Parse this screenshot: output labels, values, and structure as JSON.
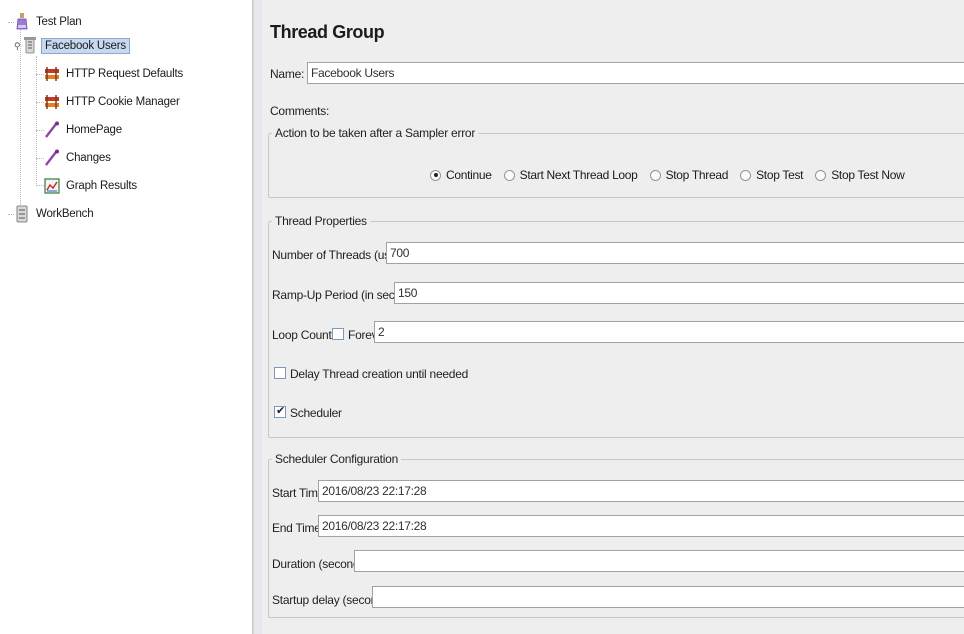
{
  "tree": {
    "items": [
      {
        "label": "Test Plan",
        "icon": "test-plan-icon"
      },
      {
        "label": "Facebook Users",
        "icon": "thread-group-icon",
        "selected": true
      },
      {
        "label": "HTTP Request Defaults",
        "icon": "config-element-icon"
      },
      {
        "label": "HTTP Cookie Manager",
        "icon": "config-element-icon"
      },
      {
        "label": "HomePage",
        "icon": "sampler-pipette-icon"
      },
      {
        "label": "Changes",
        "icon": "sampler-pipette-icon"
      },
      {
        "label": "Graph Results",
        "icon": "graph-results-icon"
      },
      {
        "label": "WorkBench",
        "icon": "workbench-icon"
      }
    ]
  },
  "panel": {
    "title": "Thread Group",
    "name_label": "Name:",
    "name_value": "Facebook Users",
    "comments_label": "Comments:",
    "sampler_error": {
      "legend": "Action to be taken after a Sampler error",
      "options": [
        "Continue",
        "Start Next Thread Loop",
        "Stop Thread",
        "Stop Test",
        "Stop Test Now"
      ],
      "selected": "Continue"
    },
    "thread_properties": {
      "legend": "Thread Properties",
      "threads_label": "Number of Threads (users):",
      "threads_value": "700",
      "rampup_label": "Ramp-Up Period (in seconds):",
      "rampup_value": "150",
      "loop_label": "Loop Count:",
      "forever_label": "Forever",
      "forever_checked": false,
      "loop_value": "2",
      "delay_label": "Delay Thread creation until needed",
      "delay_checked": false,
      "scheduler_label": "Scheduler",
      "scheduler_checked": true
    },
    "scheduler_config": {
      "legend": "Scheduler Configuration",
      "start_label": "Start Time",
      "start_value": "2016/08/23 22:17:28",
      "end_label": "End Time",
      "end_value": "2016/08/23 22:17:28",
      "duration_label": "Duration (seconds)",
      "duration_value": "",
      "delay_label": "Startup delay (seconds)",
      "delay_value": ""
    }
  },
  "colors": {
    "selection_bg": "#c7d9ef",
    "panel_bg": "#eeeeee",
    "field_border": "#9ea3a9"
  }
}
